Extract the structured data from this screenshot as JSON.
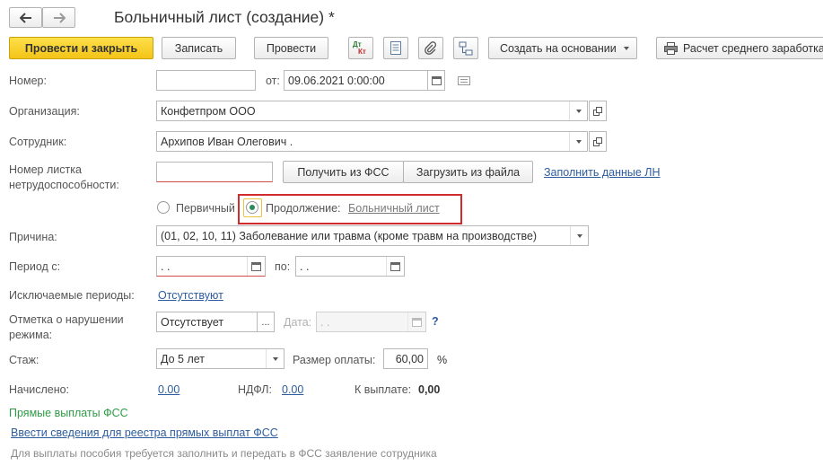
{
  "window": {
    "title": "Больничный лист (создание) *"
  },
  "nav": {
    "back_icon": "arrow-left-icon",
    "forward_icon": "arrow-right-icon"
  },
  "toolbar": {
    "post_close": "Провести и закрыть",
    "save": "Записать",
    "post": "Провести",
    "dt_label": "Дт",
    "kt_label": "Кт",
    "create_based": "Создать на основании",
    "calc_avg": "Расчет среднего заработка"
  },
  "form": {
    "number_label": "Номер:",
    "number_value": "",
    "from_label": "от:",
    "date_value": "09.06.2021  0:00:00",
    "org_label": "Организация:",
    "org_value": "Конфетпром ООО",
    "employee_label": "Сотрудник:",
    "employee_value": "Архипов Иван Олегович .",
    "sheet_number_label_1": "Номер листка",
    "sheet_number_label_2": "нетрудоспособности:",
    "sheet_number_value": "",
    "get_fss": "Получить из ФСС",
    "load_file": "Загрузить из файла",
    "fill_ln": "Заполнить данные ЛН",
    "primary": "Первичный",
    "continuation": "Продолжение:",
    "sick_leave_link": "Больничный лист",
    "reason_label": "Причина:",
    "reason_value": "(01, 02, 10, 11) Заболевание или травма (кроме травм на производстве)",
    "period_from_label": "Период с:",
    "period_from_value": " .  .",
    "period_to_label": "по:",
    "period_to_value": " .  .",
    "excluded_label": "Исключаемые периоды:",
    "excluded_value": "Отсутствуют",
    "violation_label_1": "Отметка о нарушении",
    "violation_label_2": "режима:",
    "violation_value": "Отсутствует",
    "date_label": "Дата:",
    "date_disabled_value": " .  .",
    "help": "?",
    "experience_label": "Стаж:",
    "experience_value": "До 5 лет",
    "pay_size_label": "Размер оплаты:",
    "pay_size_value": "60,00",
    "percent": "%",
    "accrued_label": "Начислено:",
    "accrued_value": "0.00",
    "ndfl_label": "НДФЛ:",
    "ndfl_value": "0.00",
    "to_pay_label": "К выплате:",
    "to_pay_value": "0,00",
    "fss_heading": "Прямые выплаты ФСС",
    "fss_link": "Ввести сведения для реестра прямых выплат ФСС",
    "fss_note": "Для выплаты пособия требуется заполнить и передать в ФСС заявление сотрудника"
  },
  "colors": {
    "accent": "#f4c418",
    "link": "#2d5c9e",
    "fss_heading": "#2e9a46",
    "highlight": "#d12b2b"
  }
}
